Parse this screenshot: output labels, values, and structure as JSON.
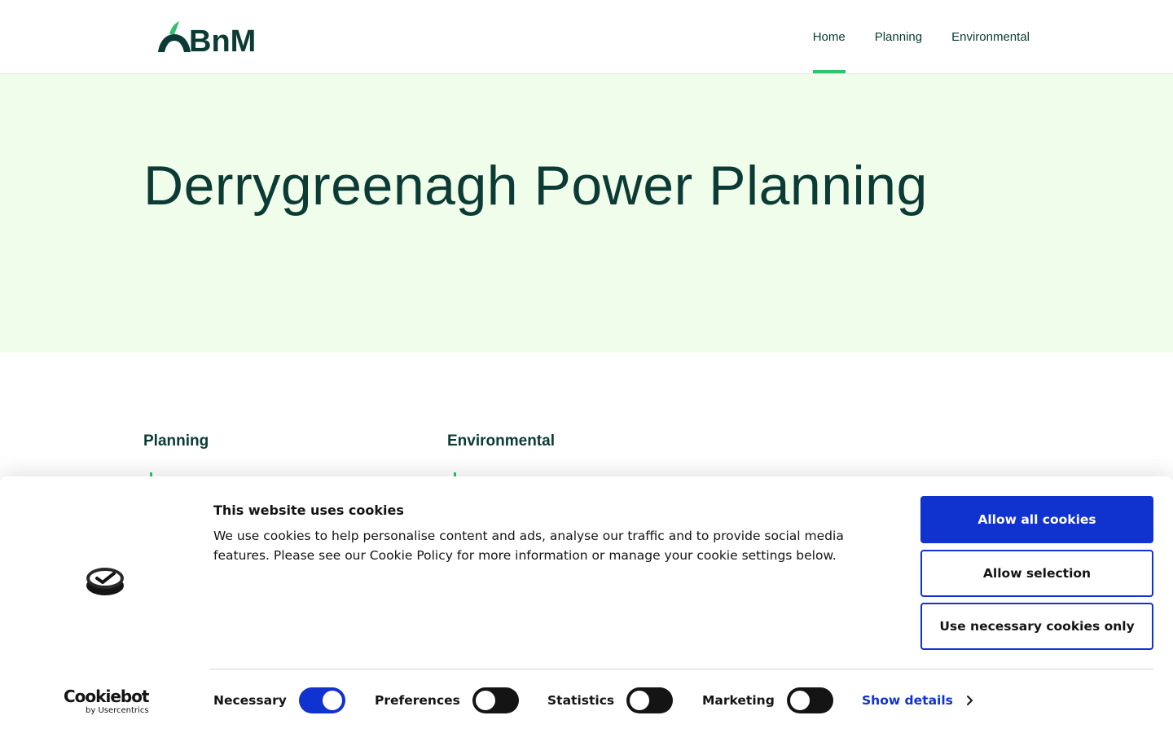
{
  "header": {
    "logo_text": "BnM",
    "nav": [
      {
        "label": "Home",
        "active": true
      },
      {
        "label": "Planning",
        "active": false
      },
      {
        "label": "Environmental",
        "active": false
      }
    ]
  },
  "hero": {
    "title": "Derrygreenagh Power Planning"
  },
  "sections": [
    {
      "title": "Planning"
    },
    {
      "title": "Environmental"
    }
  ],
  "cookie_banner": {
    "heading": "This website uses cookies",
    "text": "We use cookies to help personalise content and ads, analyse our traffic and to provide social media features. Please see our Cookie Policy for more information or manage your cookie settings below.",
    "buttons": {
      "allow_all": "Allow all cookies",
      "allow_selection": "Allow selection",
      "necessary_only": "Use necessary cookies only"
    },
    "toggles": [
      {
        "label": "Necessary",
        "on": true
      },
      {
        "label": "Preferences",
        "on": false
      },
      {
        "label": "Statistics",
        "on": false
      },
      {
        "label": "Marketing",
        "on": false
      }
    ],
    "show_details": "Show details",
    "brand": {
      "name": "Cookiebot",
      "sub": "by Usercentrics"
    }
  },
  "colors": {
    "brand_dark": "#0b3b34",
    "brand_green": "#2fc26e",
    "hero_bg": "#f0fdeb",
    "cookie_blue": "#1032cf"
  }
}
